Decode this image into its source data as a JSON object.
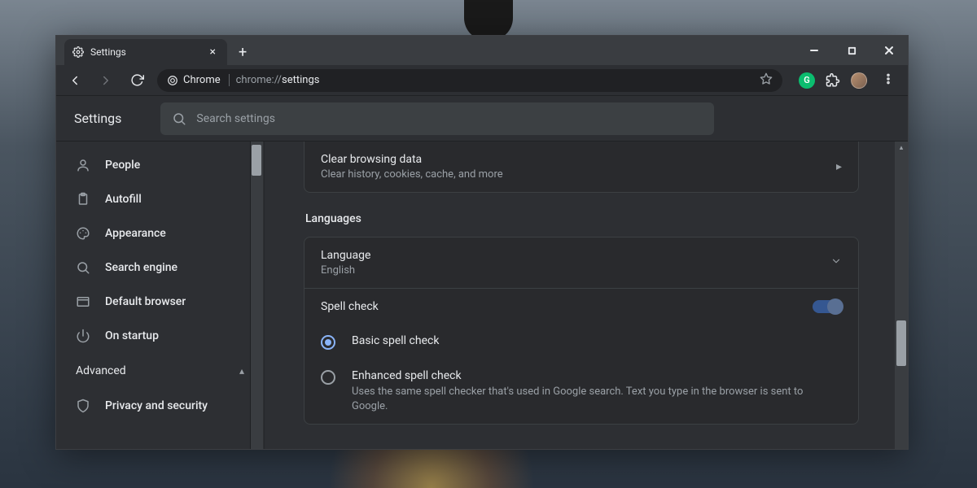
{
  "window": {
    "tab_title": "Settings",
    "url_chip": "Chrome",
    "url_path1": "chrome://",
    "url_path2": "settings"
  },
  "ext_green_letter": "G",
  "settings": {
    "title": "Settings",
    "search_placeholder": "Search settings"
  },
  "sidebar": {
    "items": [
      {
        "label": "People"
      },
      {
        "label": "Autofill"
      },
      {
        "label": "Appearance"
      },
      {
        "label": "Search engine"
      },
      {
        "label": "Default browser"
      },
      {
        "label": "On startup"
      }
    ],
    "advanced_label": "Advanced",
    "privacy_label": "Privacy and security"
  },
  "main": {
    "cbd_title": "Clear browsing data",
    "cbd_sub": "Clear history, cookies, cache, and more",
    "languages_heading": "Languages",
    "language_title": "Language",
    "language_value": "English",
    "spellcheck_label": "Spell check",
    "basic_label": "Basic spell check",
    "enhanced_label": "Enhanced spell check",
    "enhanced_sub": "Uses the same spell checker that's used in Google search. Text you type in the browser is sent to Google."
  }
}
